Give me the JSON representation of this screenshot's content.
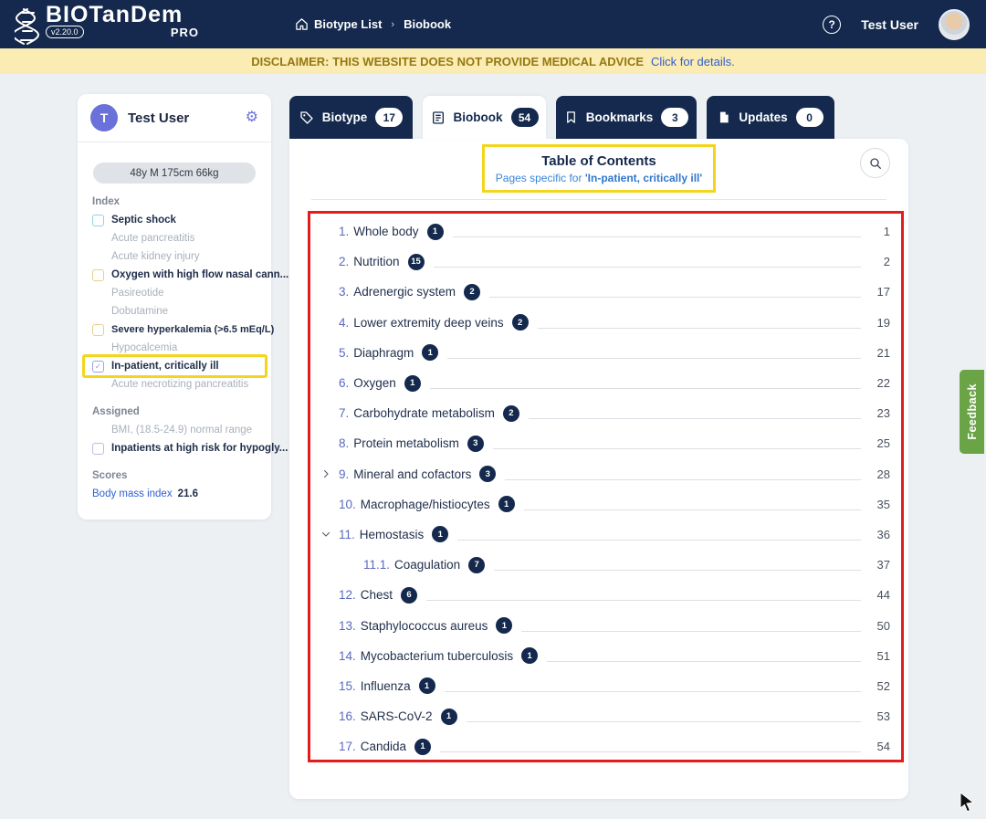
{
  "colors": {
    "navy": "#14294d",
    "highlight_yellow": "#f2d51c",
    "annotation_red": "#e51c1c",
    "feedback_green": "#6ba447",
    "link_blue": "#2f5fd0",
    "banner_yellow": "#fbecb4"
  },
  "navbar": {
    "brand_name": "BIOTanDem",
    "brand_version": "v2.20.0",
    "brand_edition": "PRO",
    "breadcrumb_home": "Biotype List",
    "breadcrumb_sep": "›",
    "breadcrumb_current": "Biobook",
    "help_glyph": "?",
    "user_name": "Test User"
  },
  "banner": {
    "text": "DISCLAIMER: THIS WEBSITE DOES NOT PROVIDE MEDICAL ADVICE",
    "link": "Click for details."
  },
  "sidebar": {
    "user_name": "Test User",
    "user_initial": "T",
    "gear_glyph": "⚙",
    "patient_summary": "48y M 175cm 66kg",
    "index_label": "Index",
    "index_items": [
      {
        "label": "Septic shock",
        "checkbox": "cyan"
      },
      {
        "label": "Acute pancreatitis"
      },
      {
        "label": "Acute kidney injury"
      },
      {
        "label": "Oxygen with high flow nasal cann...",
        "checkbox": "yellow"
      },
      {
        "label": "Pasireotide"
      },
      {
        "label": "Dobutamine"
      },
      {
        "label": "Severe hyperkalemia (>6.5 mEq/L)",
        "checkbox": "yellow"
      },
      {
        "label": "Hypocalcemia"
      },
      {
        "label": "In-patient, critically ill",
        "checkbox": "checked",
        "highlighted": true,
        "check_glyph": "✓"
      },
      {
        "label": "Acute necrotizing pancreatitis"
      }
    ],
    "assigned_label": "Assigned",
    "assigned_items": [
      {
        "label": "BMI, (18.5-24.9) normal range"
      },
      {
        "label": "Inpatients at high risk for hypogly...",
        "checkbox": "purple"
      }
    ],
    "scores_label": "Scores",
    "score_name": "Body mass index",
    "score_value": "21.6"
  },
  "tabs": [
    {
      "label": "Biotype",
      "count": "17",
      "icon": "tag-icon",
      "active": false
    },
    {
      "label": "Biobook",
      "count": "54",
      "icon": "book-icon",
      "active": true
    },
    {
      "label": "Bookmarks",
      "count": "3",
      "icon": "bookmark-icon",
      "active": false
    },
    {
      "label": "Updates",
      "count": "0",
      "icon": "file-icon",
      "active": false
    }
  ],
  "toc": {
    "title": "Table of Contents",
    "subtitle_prefix": "Pages specific for ",
    "subtitle_emphasis": "'In-patient, critically ill'",
    "items": [
      {
        "num": "1.",
        "label": "Whole body",
        "count": "1",
        "page": "1"
      },
      {
        "num": "2.",
        "label": "Nutrition",
        "count": "15",
        "page": "2"
      },
      {
        "num": "3.",
        "label": "Adrenergic system",
        "count": "2",
        "page": "17"
      },
      {
        "num": "4.",
        "label": "Lower extremity deep veins",
        "count": "2",
        "page": "19"
      },
      {
        "num": "5.",
        "label": "Diaphragm",
        "count": "1",
        "page": "21"
      },
      {
        "num": "6.",
        "label": "Oxygen",
        "count": "1",
        "page": "22"
      },
      {
        "num": "7.",
        "label": "Carbohydrate metabolism",
        "count": "2",
        "page": "23"
      },
      {
        "num": "8.",
        "label": "Protein metabolism",
        "count": "3",
        "page": "25"
      },
      {
        "num": "9.",
        "label": "Mineral and cofactors",
        "count": "3",
        "page": "28",
        "chevron": "right"
      },
      {
        "num": "10.",
        "label": "Macrophage/histiocytes",
        "count": "1",
        "page": "35"
      },
      {
        "num": "11.",
        "label": "Hemostasis",
        "count": "1",
        "page": "36",
        "chevron": "down"
      },
      {
        "num": "11.1.",
        "label": "Coagulation",
        "count": "7",
        "page": "37",
        "sub": true
      },
      {
        "num": "12.",
        "label": "Chest",
        "count": "6",
        "page": "44"
      },
      {
        "num": "13.",
        "label": "Staphylococcus aureus",
        "count": "1",
        "page": "50"
      },
      {
        "num": "14.",
        "label": "Mycobacterium tuberculosis",
        "count": "1",
        "page": "51"
      },
      {
        "num": "15.",
        "label": "Influenza",
        "count": "1",
        "page": "52"
      },
      {
        "num": "16.",
        "label": "SARS-CoV-2",
        "count": "1",
        "page": "53"
      },
      {
        "num": "17.",
        "label": "Candida",
        "count": "1",
        "page": "54"
      }
    ]
  },
  "feedback_label": "Feedback"
}
